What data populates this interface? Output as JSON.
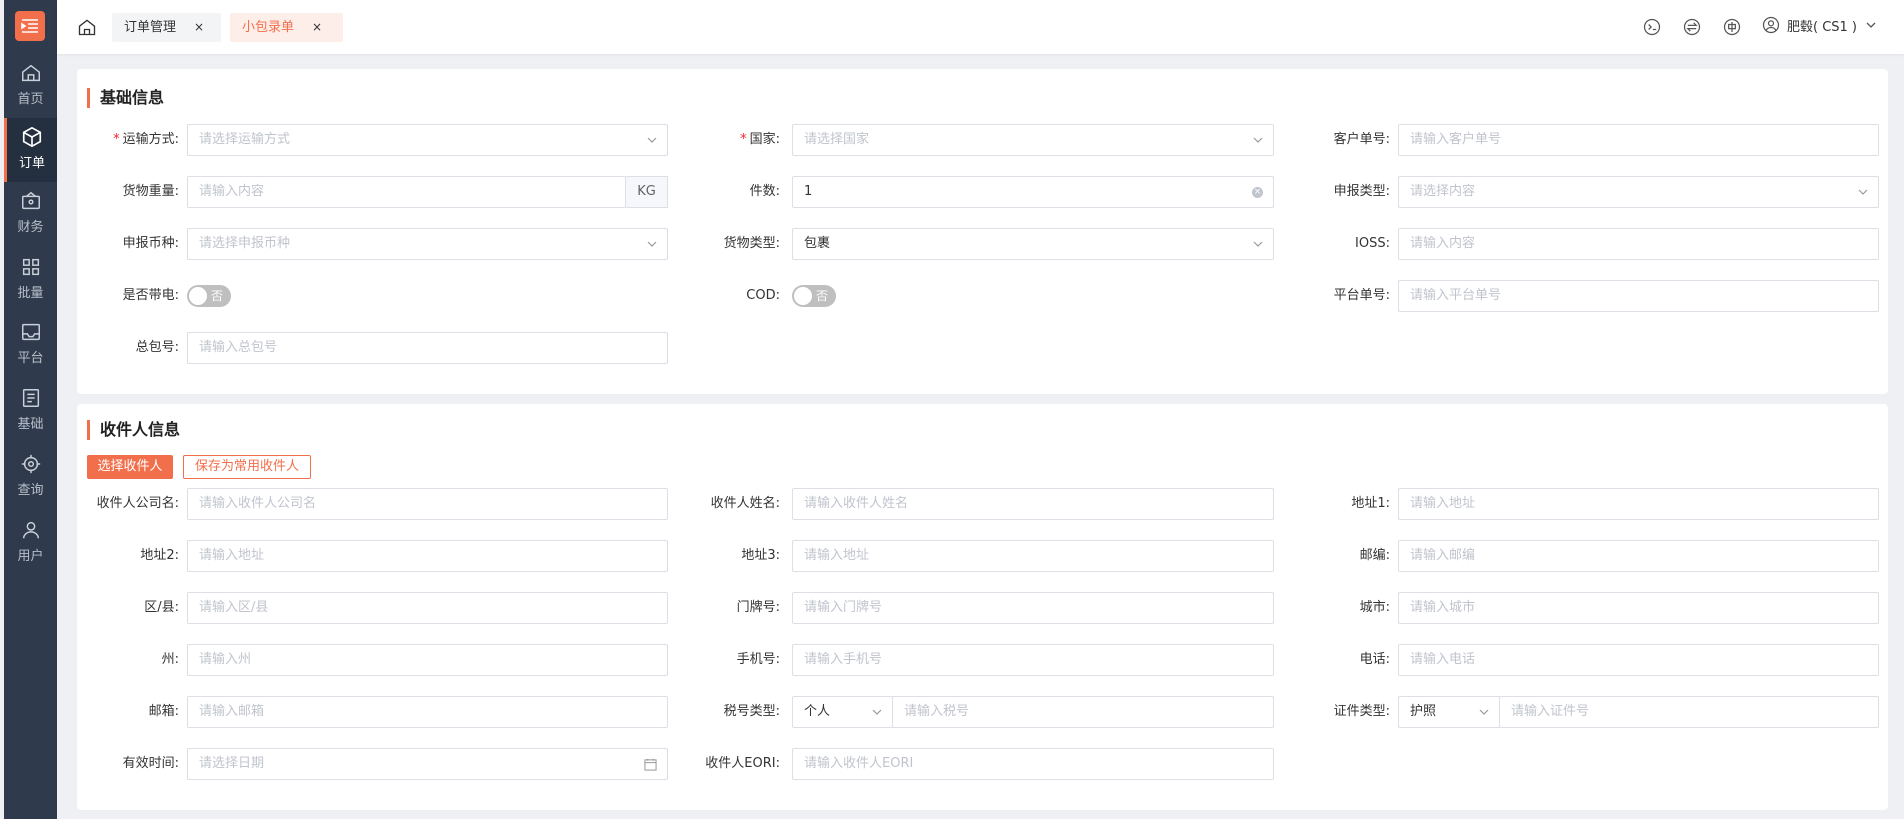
{
  "sidebar": {
    "items": [
      {
        "label": "首页",
        "icon": "home-icon"
      },
      {
        "label": "订单",
        "icon": "box-icon"
      },
      {
        "label": "财务",
        "icon": "wallet-icon"
      },
      {
        "label": "批量",
        "icon": "grid-icon"
      },
      {
        "label": "平台",
        "icon": "inbox-icon"
      },
      {
        "label": "基础",
        "icon": "list-icon"
      },
      {
        "label": "查询",
        "icon": "target-icon"
      },
      {
        "label": "用户",
        "icon": "user-icon"
      }
    ]
  },
  "tabs": [
    {
      "label": "订单管理",
      "close": "×"
    },
    {
      "label": "小包录单",
      "close": "×"
    }
  ],
  "user": {
    "name": "肥毂( CS1 )"
  },
  "basic": {
    "title": "基础信息",
    "transport_label": "运输方式:",
    "transport_ph": "请选择运输方式",
    "country_label": "国家:",
    "country_ph": "请选择国家",
    "customer_no_label": "客户单号:",
    "customer_no_ph": "请输入客户单号",
    "weight_label": "货物重量:",
    "weight_ph": "请输入内容",
    "weight_unit": "KG",
    "pieces_label": "件数:",
    "pieces_value": "1",
    "declare_type_label": "申报类型:",
    "declare_type_ph": "请选择内容",
    "currency_label": "申报币种:",
    "currency_ph": "请选择申报币种",
    "goods_type_label": "货物类型:",
    "goods_type_value": "包裹",
    "ioss_label": "IOSS:",
    "ioss_ph": "请输入内容",
    "battery_label": "是否带电:",
    "battery_value": "否",
    "cod_label": "COD:",
    "cod_value": "否",
    "platform_no_label": "平台单号:",
    "platform_no_ph": "请输入平台单号",
    "master_no_label": "总包号:",
    "master_no_ph": "请输入总包号"
  },
  "recipient": {
    "title": "收件人信息",
    "select_btn": "选择收件人",
    "save_btn": "保存为常用收件人",
    "company_label": "收件人公司名:",
    "company_ph": "请输入收件人公司名",
    "name_label": "收件人姓名:",
    "name_ph": "请输入收件人姓名",
    "addr1_label": "地址1:",
    "addr1_ph": "请输入地址",
    "addr2_label": "地址2:",
    "addr2_ph": "请输入地址",
    "addr3_label": "地址3:",
    "addr3_ph": "请输入地址",
    "zip_label": "邮编:",
    "zip_ph": "请输入邮编",
    "district_label": "区/县:",
    "district_ph": "请输入区/县",
    "door_label": "门牌号:",
    "door_ph": "请输入门牌号",
    "city_label": "城市:",
    "city_ph": "请输入城市",
    "state_label": "州:",
    "state_ph": "请输入州",
    "mobile_label": "手机号:",
    "mobile_ph": "请输入手机号",
    "phone_label": "电话:",
    "phone_ph": "请输入电话",
    "email_label": "邮箱:",
    "email_ph": "请输入邮箱",
    "tax_type_label": "税号类型:",
    "tax_type_value": "个人",
    "tax_no_ph": "请输入税号",
    "id_type_label": "证件类型:",
    "id_type_value": "护照",
    "id_no_ph": "请输入证件号",
    "valid_label": "有效时间:",
    "valid_ph": "请选择日期",
    "eori_label": "收件人EORI:",
    "eori_ph": "请输入收件人EORI"
  }
}
